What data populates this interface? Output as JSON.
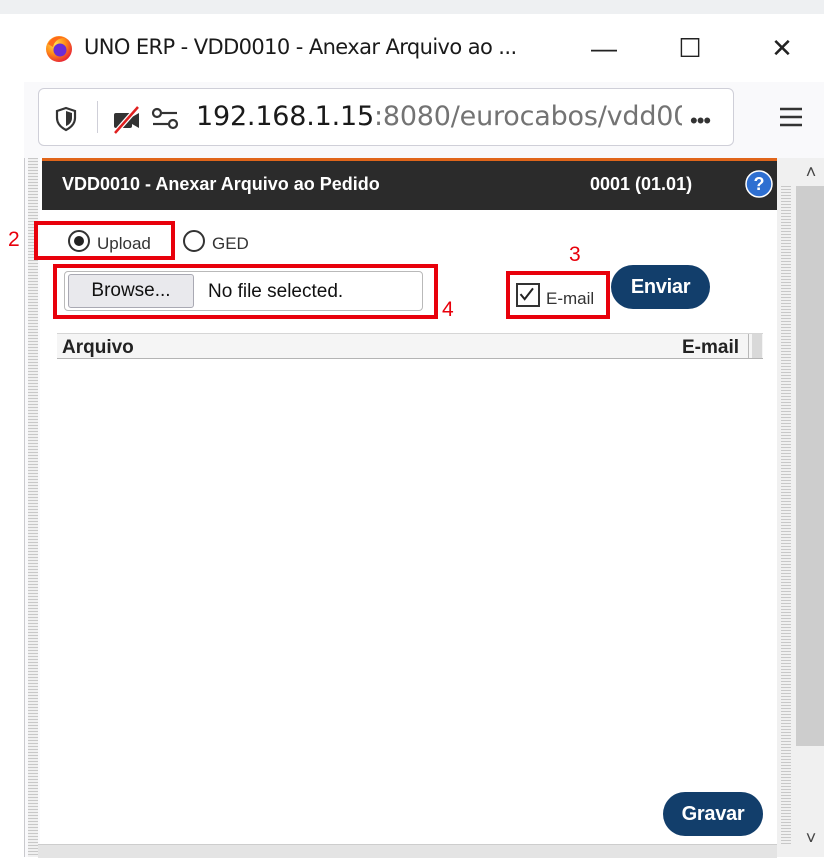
{
  "window": {
    "title": "UNO ERP - VDD0010 - Anexar Arquivo ao ...",
    "minimize": "—",
    "maximize": "☐",
    "close": "✕"
  },
  "urlbar": {
    "host": "192.168.1.15",
    "rest": ":8080/eurocabos/vdd001C",
    "more": "•••"
  },
  "scroll": {
    "up": "˄",
    "down": "˅"
  },
  "header": {
    "title": "VDD0010 - Anexar Arquivo ao Pedido",
    "code": "0001 (01.01)",
    "help_icon": "question-circle-icon",
    "accent_color": "#e0651a"
  },
  "form": {
    "source_options": [
      {
        "label": "Upload",
        "selected": true
      },
      {
        "label": "GED",
        "selected": false
      }
    ],
    "browse_label": "Browse...",
    "file_status": "No file selected.",
    "email_label": "E-mail",
    "email_checked": true,
    "send_label": "Enviar"
  },
  "grid": {
    "columns": [
      "Arquivo",
      "E-mail"
    ],
    "rows": []
  },
  "footer": {
    "save_label": "Gravar"
  },
  "annotations": [
    "2",
    "3",
    "4"
  ],
  "colors": {
    "button": "#123e6b",
    "annotation": "#e8000b"
  }
}
